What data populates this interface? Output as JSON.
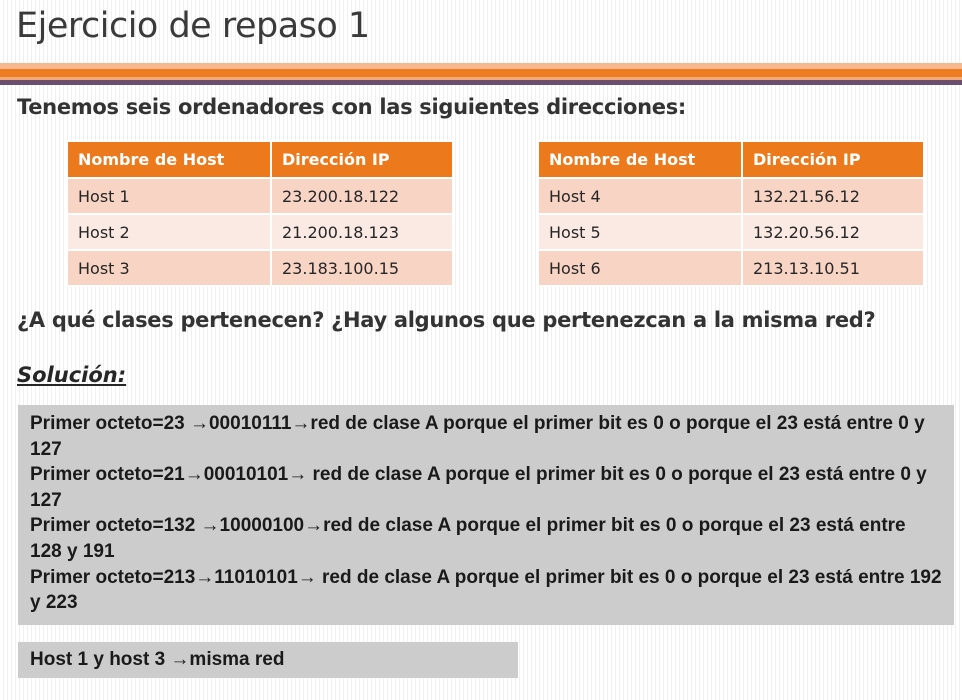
{
  "slide": {
    "title": "Ejercicio de repaso 1",
    "intro": "Tenemos seis ordenadores con las siguientes direcciones:",
    "question": "¿A qué clases pertenecen? ¿Hay algunos que pertenezcan a la misma red?",
    "solution_label": "Solución:"
  },
  "table_left": {
    "headers": [
      "Nombre de Host",
      "Dirección IP"
    ],
    "rows": [
      [
        "Host 1",
        "23.200.18.122"
      ],
      [
        "Host 2",
        "21.200.18.123"
      ],
      [
        "Host 3",
        "23.183.100.15"
      ]
    ]
  },
  "table_right": {
    "headers": [
      "Nombre de Host",
      "Dirección IP"
    ],
    "rows": [
      [
        "Host 4",
        "132.21.56.12"
      ],
      [
        "Host 5",
        "132.20.56.12"
      ],
      [
        "Host 6",
        "213.13.10.51"
      ]
    ]
  },
  "solution": {
    "lines": [
      "Primer octeto=23 →00010111→red de clase A porque el primer bit es 0 o porque el 23 está entre 0 y 127",
      "Primer octeto=21→00010101→ red de clase A porque el primer bit es 0 o porque el 23 está entre 0 y 127",
      "Primer octeto=132 →10000100→red de clase A porque el primer bit es 0 o porque el 23 está entre 128 y 191",
      "Primer octeto=213→11010101→ red de clase A porque el primer bit es 0 o porque el 23 está entre 192 y 223"
    ],
    "conclusion": "Host 1 y host 3 →misma red"
  },
  "colors": {
    "header_orange": "#ec7a1c",
    "row_odd": "#f8d4c5",
    "row_even": "#fbeae3",
    "band_purple": "#6a4f6e",
    "box_gray": "#cccccc"
  }
}
